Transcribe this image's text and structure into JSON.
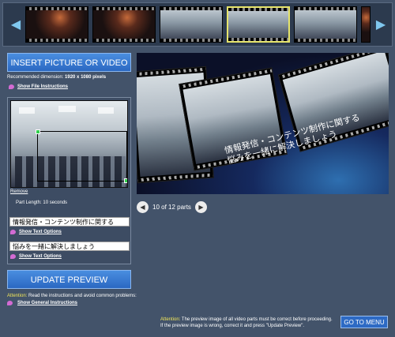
{
  "filmstrip": {
    "prev_arrow": "left-arrow-icon",
    "next_arrow": "right-arrow-icon",
    "thumbnails": [
      {
        "caption": "",
        "selected": false
      },
      {
        "caption": "",
        "selected": false
      },
      {
        "caption": "",
        "selected": false
      },
      {
        "caption": "",
        "selected": true
      },
      {
        "caption": "",
        "selected": false
      }
    ]
  },
  "left_panel": {
    "insert_button": "INSERT PICTURE OR VIDEO",
    "recommended_label": "Recommended dimension: ",
    "recommended_value": "1920 x 1080 pixels",
    "file_instructions_link": "Show File Instructions",
    "remove_link": "Remove",
    "part_length": "Part Length:  10 seconds",
    "text_option_1_value": "情報発信・コンテンツ制作に関する",
    "text_option_1_link": "Show Text Options",
    "text_option_2_value": "悩みを一緒に解決しましょう",
    "text_option_2_link": "Show Text Options",
    "update_button": "UPDATE PREVIEW",
    "attention_word": "Attention:",
    "attention_text": " Read the instructions and avoid common problems:",
    "general_instructions_link": "Show General Instructions"
  },
  "preview": {
    "caption_line_1": "情報発信・コンテンツ制作に関する",
    "caption_line_2": "悩みを一緒に解決しましょう"
  },
  "pager": {
    "text": "10 of 12 parts",
    "prev_icon": "left-arrow-icon",
    "next_icon": "right-arrow-icon",
    "progress": {
      "current": 10,
      "total": 12
    }
  },
  "footer": {
    "attention_word": "Attention:",
    "attention_line_1": " The preview image of all video parts must be correct before proceeding.",
    "attention_line_2": "If the preview image is wrong, correct it and press \"Update Preview\".",
    "go_menu_button": "GO TO MENU"
  },
  "colors": {
    "background": "#43536a",
    "button_blue": "#2b68c2",
    "accent_yellow": "#e7e56b",
    "handle_green": "#33d14f",
    "bullet_pink": "#d36bd3"
  }
}
